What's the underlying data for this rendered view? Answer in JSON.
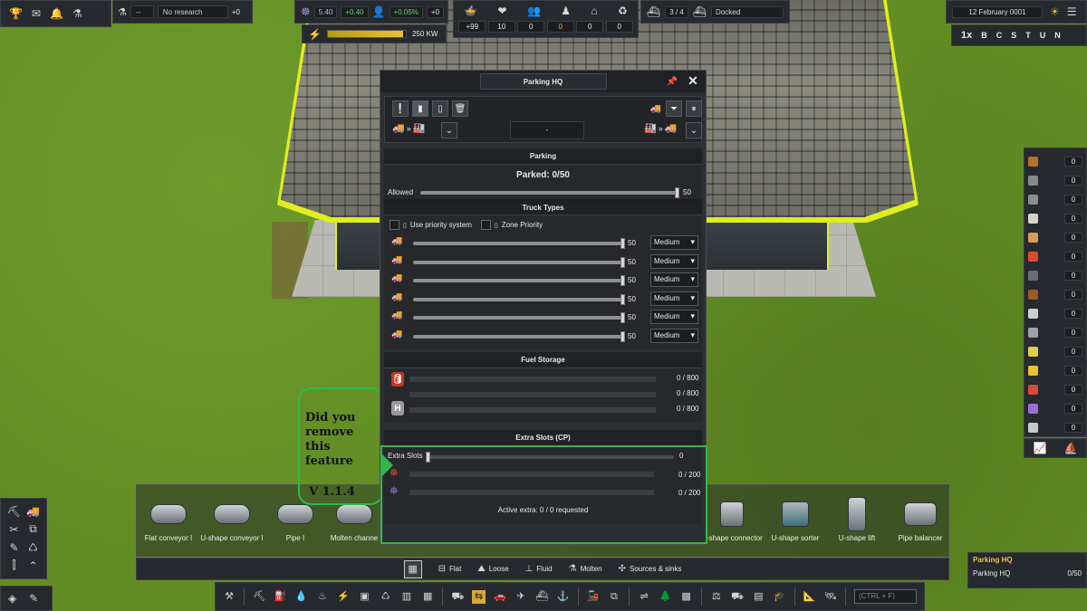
{
  "top_left": {
    "research_label": "No research",
    "research_value": "--",
    "research_gain": "+0"
  },
  "unity": {
    "value": "5.40",
    "delta": "+0.40",
    "pop_pct": "+0.05%",
    "pop_delta": "+0"
  },
  "power": {
    "value": "250 KW",
    "fill_fraction": 0.97
  },
  "population": {
    "values": [
      "+99",
      "10",
      "0",
      "0",
      "0",
      "0"
    ]
  },
  "ships": {
    "count": "3 / 4",
    "status": "Docked"
  },
  "date": {
    "text": "12 February 0001"
  },
  "speed": {
    "labels": [
      "1x",
      "B",
      "C",
      "S",
      "T",
      "U",
      "N"
    ]
  },
  "resources": {
    "items": [
      {
        "value": "0",
        "color": "#b5722d"
      },
      {
        "value": "0",
        "color": "#8a8a8a"
      },
      {
        "value": "0",
        "color": "#8c8c8c"
      },
      {
        "value": "0",
        "color": "#d7d2c6"
      },
      {
        "value": "0",
        "color": "#d99b58"
      },
      {
        "value": "0",
        "color": "#e04a2c"
      },
      {
        "value": "0",
        "color": "#6a6e78"
      },
      {
        "value": "0",
        "color": "#9c5a2a"
      },
      {
        "value": "0",
        "color": "#cfcfcf"
      },
      {
        "value": "0",
        "color": "#9fa3a7"
      },
      {
        "value": "0",
        "color": "#ddd04c"
      },
      {
        "value": "0",
        "color": "#e8c12b"
      },
      {
        "value": "0",
        "color": "#d84a3a"
      },
      {
        "value": "0",
        "color": "#9b6fd4"
      },
      {
        "value": "0",
        "color": "#c9c9c9"
      }
    ]
  },
  "window": {
    "title": "Parking HQ",
    "center_field": "-",
    "parking": {
      "header": "Parking",
      "parked": "Parked: 0/50",
      "allowed_label": "Allowed",
      "allowed_value": "50",
      "allowed_fraction": 1.0
    },
    "truck_types": {
      "header": "Truck Types",
      "use_priority": "Use priority system",
      "zone_priority": "Zone Priority",
      "rows": [
        {
          "value": "50",
          "priority": "Medium"
        },
        {
          "value": "50",
          "priority": "Medium"
        },
        {
          "value": "50",
          "priority": "Medium"
        },
        {
          "value": "50",
          "priority": "Medium"
        },
        {
          "value": "50",
          "priority": "Medium"
        },
        {
          "value": "50",
          "priority": "Medium"
        }
      ]
    },
    "fuel": {
      "header": "Fuel Storage",
      "rows": [
        {
          "value": "0 / 800"
        },
        {
          "value": "0 / 800"
        },
        {
          "value": "0 / 800"
        }
      ]
    },
    "extra": {
      "header": "Extra Slots (CP)",
      "slots_label": "Extra Slots",
      "slots_value": "0",
      "rows": [
        {
          "value": "0 / 200"
        },
        {
          "value": "0 / 200"
        }
      ],
      "active": "Active extra: 0 / 0 requested"
    }
  },
  "annotation": {
    "text": "Did you remove this feature",
    "version": "V 1.1.4"
  },
  "build_tools": {
    "items": [
      "Flat conveyor I",
      "U-shape conveyor I",
      "Pipe I",
      "Molten channe",
      "U-shape connector",
      "U-shape sorter",
      "U-shape lift",
      "Pipe balancer"
    ]
  },
  "filters": {
    "items": [
      "Flat",
      "Loose",
      "Fluid",
      "Molten",
      "Sources & sinks"
    ]
  },
  "search": {
    "placeholder": "(CTRL + F)"
  },
  "notification": {
    "header": "Parking HQ",
    "item": "Parking HQ",
    "value": "0/50"
  }
}
